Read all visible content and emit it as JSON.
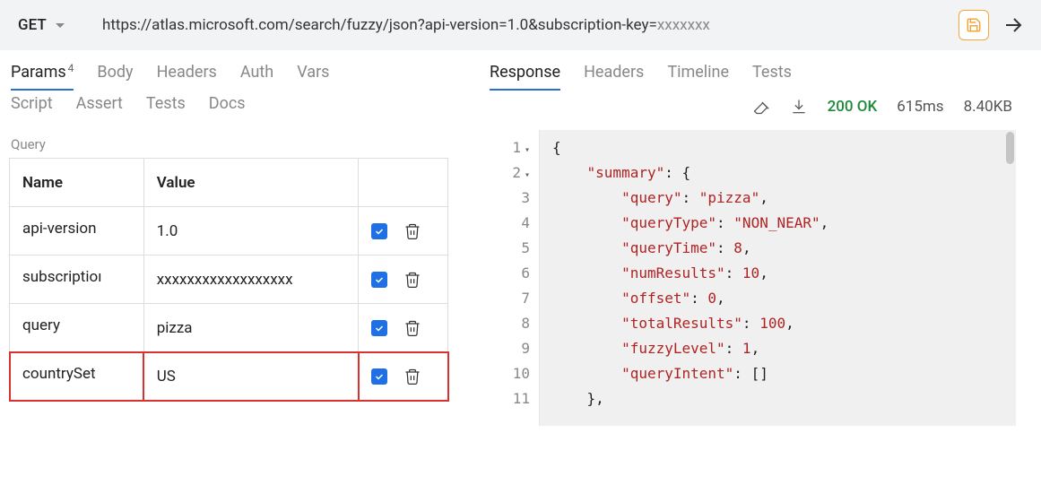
{
  "request": {
    "method": "GET",
    "url_visible": "https://atlas.microsoft.com/search/fuzzy/json?api-version=1.0&subscription-key=",
    "url_masked": "xxxxxxx"
  },
  "left_tabs_row1": [
    {
      "label": "Params",
      "active": true,
      "badge": "4"
    },
    {
      "label": "Body"
    },
    {
      "label": "Headers"
    },
    {
      "label": "Auth"
    },
    {
      "label": "Vars"
    }
  ],
  "left_tabs_row2": [
    {
      "label": "Script"
    },
    {
      "label": "Assert"
    },
    {
      "label": "Tests"
    },
    {
      "label": "Docs"
    }
  ],
  "query_label": "Query",
  "params_table": {
    "headers": [
      "Name",
      "Value",
      ""
    ],
    "rows": [
      {
        "name": "api-version",
        "value": "1.0",
        "checked": true,
        "highlight": false
      },
      {
        "name": "subscription-key",
        "value": "xxxxxxxxxxxxxxxxxx",
        "checked": true,
        "highlight": false,
        "name_display": "subscriptioı"
      },
      {
        "name": "query",
        "value": "pizza",
        "checked": true,
        "highlight": false
      },
      {
        "name": "countrySet",
        "value": "US",
        "checked": true,
        "highlight": true
      }
    ]
  },
  "right_tabs": [
    {
      "label": "Response",
      "active": true
    },
    {
      "label": "Headers"
    },
    {
      "label": "Timeline"
    },
    {
      "label": "Tests"
    }
  ],
  "response_meta": {
    "status": "200 OK",
    "time": "615ms",
    "size": "8.40KB"
  },
  "response_lines": [
    {
      "n": "1",
      "fold": true,
      "indent": 0,
      "tokens": [
        {
          "t": "{",
          "c": "j-punc"
        }
      ]
    },
    {
      "n": "2",
      "fold": true,
      "indent": 1,
      "tokens": [
        {
          "t": "\"summary\"",
          "c": "j-keyq"
        },
        {
          "t": ": {",
          "c": "j-punc"
        }
      ]
    },
    {
      "n": "3",
      "indent": 2,
      "tokens": [
        {
          "t": "\"query\"",
          "c": "j-keyq"
        },
        {
          "t": ": ",
          "c": "j-punc"
        },
        {
          "t": "\"pizza\"",
          "c": "j-str"
        },
        {
          "t": ",",
          "c": "j-punc"
        }
      ]
    },
    {
      "n": "4",
      "indent": 2,
      "tokens": [
        {
          "t": "\"queryType\"",
          "c": "j-keyq"
        },
        {
          "t": ": ",
          "c": "j-punc"
        },
        {
          "t": "\"NON_NEAR\"",
          "c": "j-str"
        },
        {
          "t": ",",
          "c": "j-punc"
        }
      ]
    },
    {
      "n": "5",
      "indent": 2,
      "tokens": [
        {
          "t": "\"queryTime\"",
          "c": "j-keyq"
        },
        {
          "t": ": ",
          "c": "j-punc"
        },
        {
          "t": "8",
          "c": "j-num"
        },
        {
          "t": ",",
          "c": "j-punc"
        }
      ]
    },
    {
      "n": "6",
      "indent": 2,
      "tokens": [
        {
          "t": "\"numResults\"",
          "c": "j-keyq"
        },
        {
          "t": ": ",
          "c": "j-punc"
        },
        {
          "t": "10",
          "c": "j-num"
        },
        {
          "t": ",",
          "c": "j-punc"
        }
      ]
    },
    {
      "n": "7",
      "indent": 2,
      "tokens": [
        {
          "t": "\"offset\"",
          "c": "j-keyq"
        },
        {
          "t": ": ",
          "c": "j-punc"
        },
        {
          "t": "0",
          "c": "j-num"
        },
        {
          "t": ",",
          "c": "j-punc"
        }
      ]
    },
    {
      "n": "8",
      "indent": 2,
      "tokens": [
        {
          "t": "\"totalResults\"",
          "c": "j-keyq"
        },
        {
          "t": ": ",
          "c": "j-punc"
        },
        {
          "t": "100",
          "c": "j-num"
        },
        {
          "t": ",",
          "c": "j-punc"
        }
      ]
    },
    {
      "n": "9",
      "indent": 2,
      "tokens": [
        {
          "t": "\"fuzzyLevel\"",
          "c": "j-keyq"
        },
        {
          "t": ": ",
          "c": "j-punc"
        },
        {
          "t": "1",
          "c": "j-num"
        },
        {
          "t": ",",
          "c": "j-punc"
        }
      ]
    },
    {
      "n": "10",
      "indent": 2,
      "tokens": [
        {
          "t": "\"queryIntent\"",
          "c": "j-keyq"
        },
        {
          "t": ": []",
          "c": "j-punc"
        }
      ]
    },
    {
      "n": "11",
      "indent": 1,
      "tokens": [
        {
          "t": "},",
          "c": "j-punc"
        }
      ]
    }
  ]
}
